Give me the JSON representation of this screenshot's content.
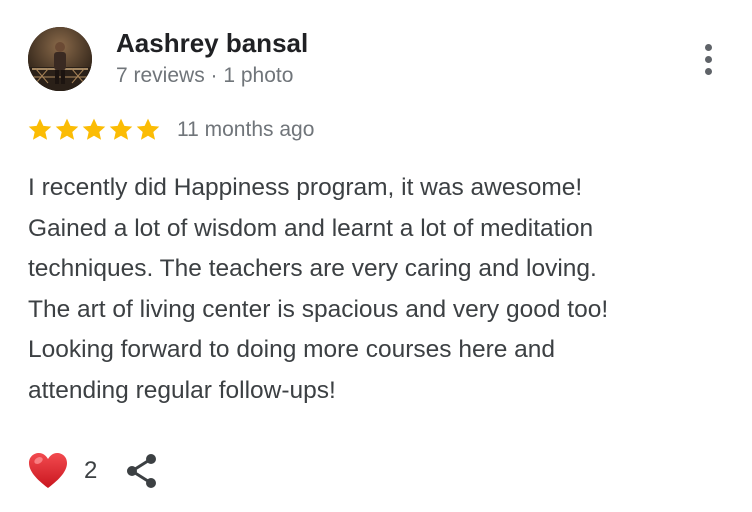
{
  "reviewer": {
    "name": "Aashrey bansal",
    "meta": "7 reviews · 1 photo"
  },
  "review": {
    "rating": 5,
    "rating_max": 5,
    "date": "11 months ago",
    "text_lines": [
      "I recently did Happiness program, it was awesome!",
      "Gained a lot of wisdom and learnt a lot of meditation",
      "techniques. The teachers are very caring and loving.",
      "The art of living center is spacious and very good too!",
      "Looking forward to doing more courses here and",
      "attending regular follow-ups!"
    ]
  },
  "actions": {
    "like_count": "2",
    "like_icon": "heart-icon",
    "share_icon": "share-icon",
    "more_icon": "more-vertical-icon"
  },
  "colors": {
    "star": "#fbbc04",
    "heart": "#e0242f",
    "name": "#202124",
    "meta": "#70757a",
    "body_text": "#3c4043"
  }
}
